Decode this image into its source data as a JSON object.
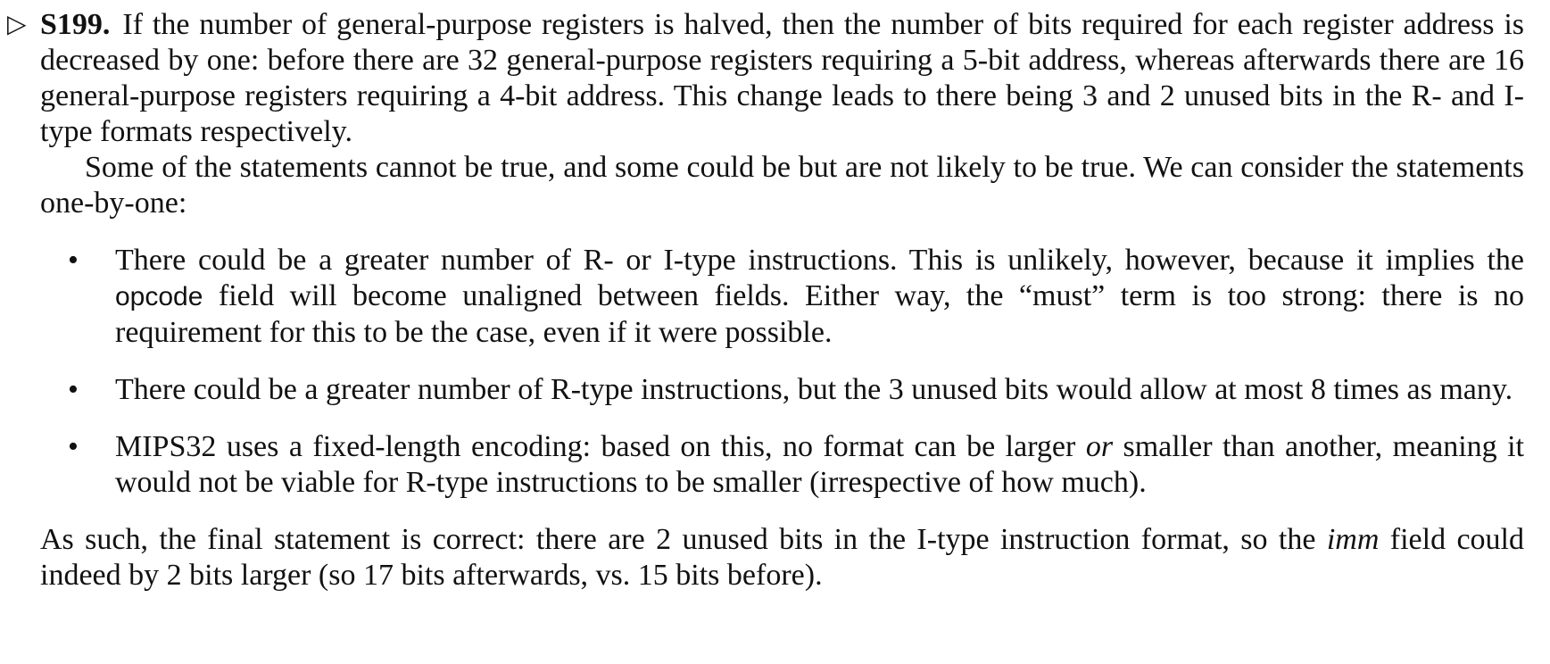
{
  "solution": {
    "marker": "▷",
    "label": "S199.",
    "intro": "If the number of general-purpose registers is halved, then the number of bits required for each register address is decreased by one: before there are 32 general-purpose registers requiring a 5-bit address, whereas afterwards there are 16 general-purpose registers requiring a 4-bit address. This change leads to there being 3 and 2 unused bits in the R- and I-type formats respectively.",
    "second": "Some of the statements cannot be true, and some could be but are not likely to be true. We can consider the statements one-by-one:",
    "bullet1": {
      "before": "There could be a greater number of R- or I-type instructions. This is unlikely, however, because it implies the ",
      "code": "opcode",
      "after": " field will become unaligned between fields. Either way, the “must” term is too strong: there is no requirement for this to be the case, even if it were possible."
    },
    "bullet2": {
      "text": "There could be a greater number of R-type instructions, but the 3 unused bits would allow at most 8 times as many."
    },
    "bullet3": {
      "before": "MIPS32 uses a fixed-length encoding: based on this, no format can be larger ",
      "em": "or",
      "after": " smaller than another, meaning it would not be viable for R-type instructions to be smaller (irrespective of how much)."
    },
    "conclusion": {
      "before": "As such, the final statement is correct: there are 2 unused bits in the I-type instruction format, so the ",
      "em": "imm",
      "after": " field could indeed by 2 bits larger (so 17 bits afterwards, vs. 15 bits before)."
    },
    "bullet_char": "•"
  }
}
